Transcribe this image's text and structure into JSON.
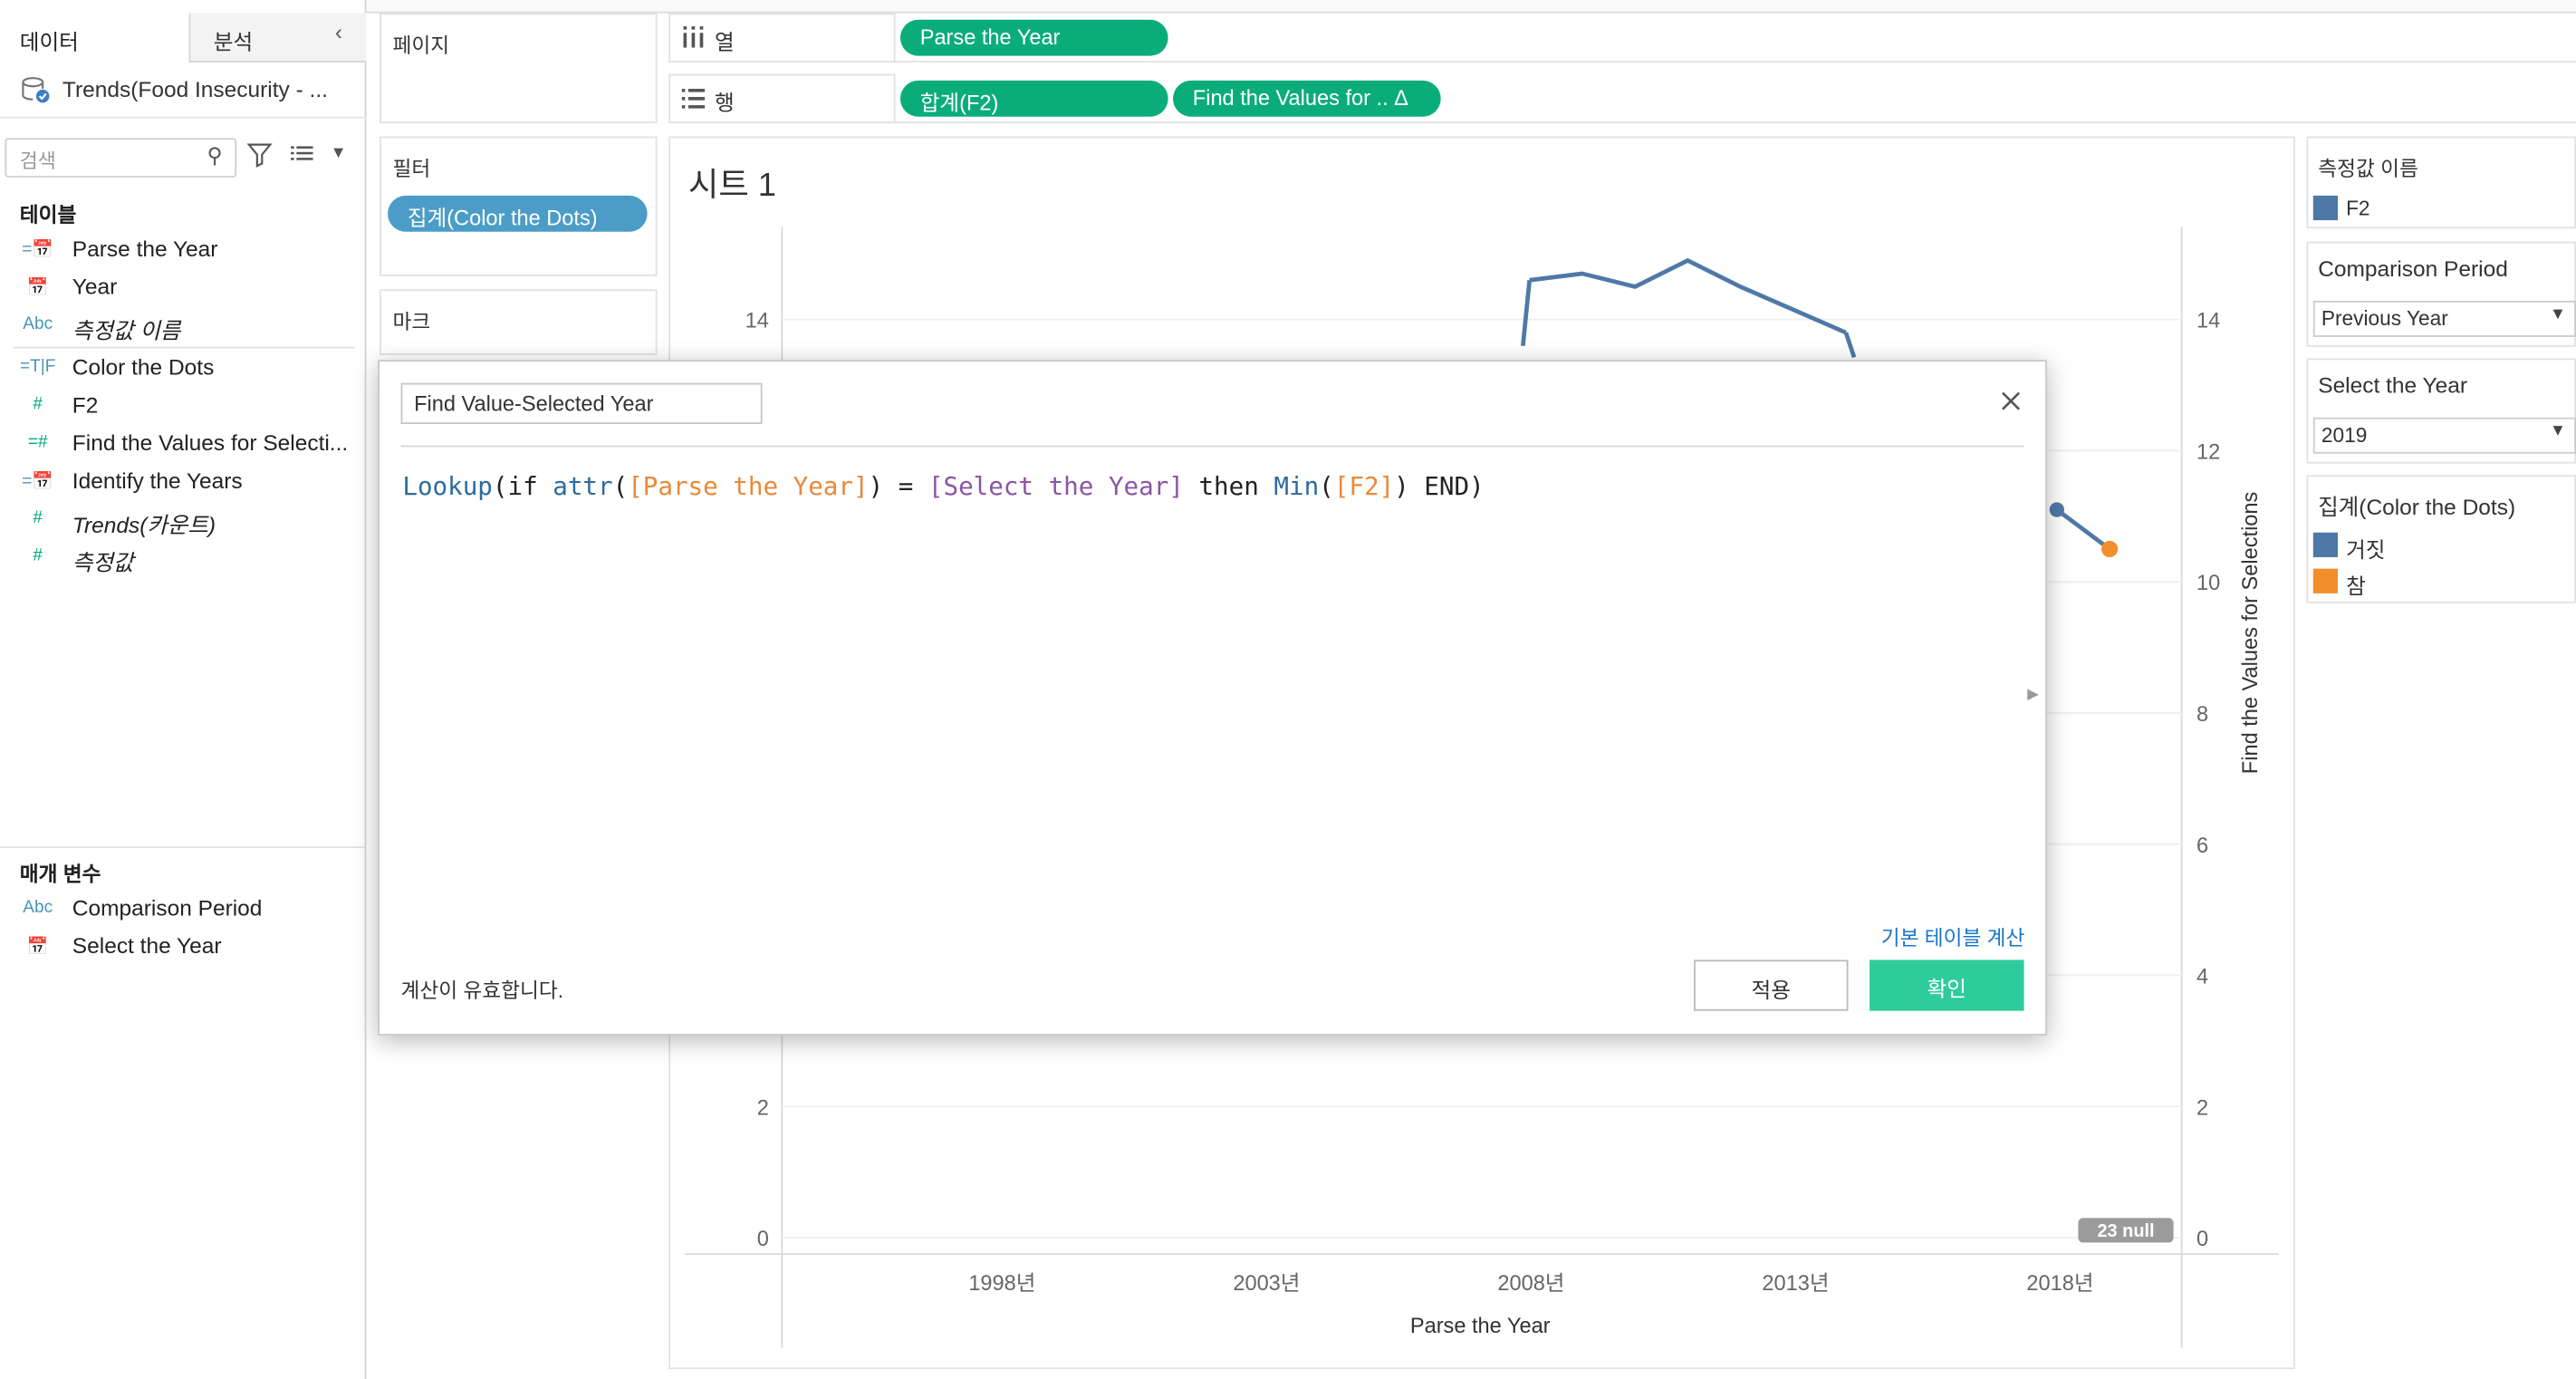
{
  "data_pane": {
    "tab_data": "데이터",
    "tab_analysis": "분석",
    "datasource_name": "Trends(Food Insecurity - ...",
    "search_placeholder": "검색",
    "tables_header": "테이블",
    "fields": [
      {
        "icon": "=📅",
        "label": "Parse the Year",
        "italic": false,
        "kind": "date-calc"
      },
      {
        "icon": "📅",
        "label": "Year",
        "italic": false,
        "kind": "date"
      },
      {
        "icon": "Abc",
        "label": "측정값 이름",
        "italic": true,
        "kind": "string"
      },
      {
        "icon": "=T|F",
        "label": "Color the Dots",
        "italic": false,
        "kind": "bool-calc"
      },
      {
        "icon": "#",
        "label": "F2",
        "italic": false,
        "kind": "number"
      },
      {
        "icon": "=#",
        "label": "Find the Values for Selecti...",
        "italic": false,
        "kind": "number-calc"
      },
      {
        "icon": "=📅",
        "label": "Identify the Years",
        "italic": false,
        "kind": "date-calc"
      },
      {
        "icon": "#",
        "label": "Trends(카운트)",
        "italic": true,
        "kind": "number"
      },
      {
        "icon": "#",
        "label": "측정값",
        "italic": true,
        "kind": "number"
      }
    ],
    "params_header": "매개 변수",
    "params": [
      {
        "icon": "Abc",
        "label": "Comparison Period"
      },
      {
        "icon": "📅",
        "label": "Select the Year"
      }
    ]
  },
  "cards": {
    "pages": "페이지",
    "filters": "필터",
    "filter_pill": "집계(Color the Dots)",
    "marks": "마크"
  },
  "shelves": {
    "columns_label": "열",
    "rows_label": "행",
    "column_pills": [
      "Parse the Year"
    ],
    "row_pills": [
      "합계(F2)",
      "Find the Values for .. Δ"
    ]
  },
  "view": {
    "sheet_title": "시트 1",
    "null_badge": "23 null"
  },
  "chart_data": {
    "type": "line",
    "x_label": "Parse the Year",
    "x_ticks": [
      "1998년",
      "2003년",
      "2008년",
      "2013년",
      "2018년"
    ],
    "y_left_ticks": [
      "0",
      "2",
      "14"
    ],
    "y_right_ticks": [
      "0",
      "2",
      "4",
      "6",
      "8",
      "10",
      "12",
      "14"
    ],
    "y_right_label": "Find the Values for Selections",
    "ylim": [
      0,
      15
    ],
    "visible_series": [
      {
        "name": "F2",
        "color": "#4e79a7",
        "x": [
          2008,
          2009,
          2010,
          2011,
          2012,
          2014
        ],
        "y": [
          14.6,
          14.7,
          14.5,
          14.9,
          14.5,
          13.8
        ]
      },
      {
        "name": "F2",
        "color": "#4e79a7",
        "x": [
          2018,
          2019
        ],
        "y": [
          11.1,
          10.5
        ]
      }
    ],
    "highlight_point": {
      "color": "#f28e2b",
      "x": 2019,
      "y": 10.5
    }
  },
  "legends": {
    "measure_title": "측정값 이름",
    "measure_item": "F2",
    "period_title": "Comparison Period",
    "period_value": "Previous Year",
    "year_title": "Select the Year",
    "year_value": "2019",
    "color_title": "집계(Color the Dots)",
    "color_items": [
      "거짓",
      "참"
    ]
  },
  "dialog": {
    "calc_name": "Find Value-Selected Year",
    "formula_parts": [
      "Lookup",
      "(if ",
      "attr",
      "(",
      "[Parse the Year]",
      ") = ",
      "[Select the Year]",
      " then ",
      "Min",
      "(",
      "[F2]",
      ") END)"
    ],
    "table_calc_link": "기본 테이블 계산",
    "valid_message": "계산이 유효합니다.",
    "apply_label": "적용",
    "ok_label": "확인"
  }
}
